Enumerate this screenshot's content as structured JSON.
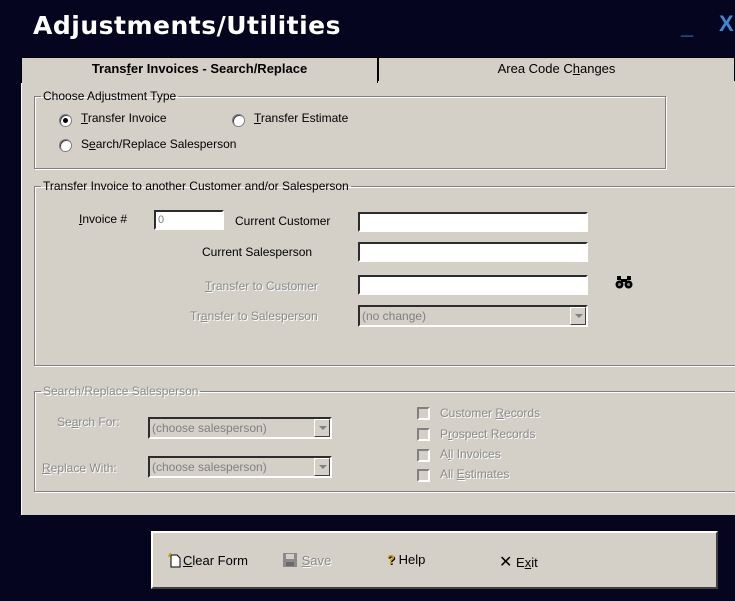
{
  "window": {
    "title": "Adjustments/Utilities",
    "min_label": "_",
    "close_label": "X"
  },
  "tabs": [
    {
      "pre": "Trans",
      "key": "f",
      "post": "er Invoices - Search/Replace",
      "active": true
    },
    {
      "pre": "Area Code C",
      "key": "h",
      "post": "anges",
      "active": false
    }
  ],
  "adjustment_type": {
    "legend": "Choose Adjustment Type",
    "options": [
      {
        "pre": "",
        "key": "T",
        "post": "ransfer Invoice",
        "checked": true
      },
      {
        "pre": "",
        "key": "T",
        "post": "ransfer Estimate",
        "checked": false
      },
      {
        "pre": "S",
        "key": "e",
        "post": "arch/Replace Salesperson",
        "checked": false
      }
    ]
  },
  "transfer": {
    "legend": "Transfer Invoice to another Customer and/or Salesperson",
    "invoice_label_key": "I",
    "invoice_label_post": "nvoice #",
    "invoice_value": "0",
    "current_customer_label": "Current Customer",
    "current_customer_value": "",
    "current_salesperson_label": "Current Salesperson",
    "current_salesperson_value": "",
    "transfer_customer_key": "T",
    "transfer_customer_post": "ransfer to Customer",
    "transfer_customer_value": "",
    "transfer_salesperson_pre": "Tr",
    "transfer_salesperson_key": "a",
    "transfer_salesperson_post": "nsfer to Salesperson",
    "transfer_salesperson_value": "(no change)",
    "find_icon": "binoculars-icon"
  },
  "search_replace": {
    "legend": "Search/Replace Salesperson",
    "search_pre": "Se",
    "search_key": "a",
    "search_post": "rch For:",
    "search_value": "(choose salesperson)",
    "replace_key": "R",
    "replace_post": "eplace With:",
    "replace_value": "(choose salesperson)",
    "checkboxes": [
      {
        "pre": "Customer ",
        "key": "R",
        "post": "ecords"
      },
      {
        "pre": "P",
        "key": "r",
        "post": "ospect Records"
      },
      {
        "pre": "A",
        "key": "l",
        "post": "l Invoices"
      },
      {
        "pre": "All ",
        "key": "E",
        "post": "stimates"
      }
    ]
  },
  "toolbar": {
    "clear_key": "C",
    "clear_post": "lear Form",
    "save_key": "S",
    "save_post": "ave",
    "help_label": "Help",
    "exit_pre": "E",
    "exit_key": "x",
    "exit_post": "it"
  }
}
